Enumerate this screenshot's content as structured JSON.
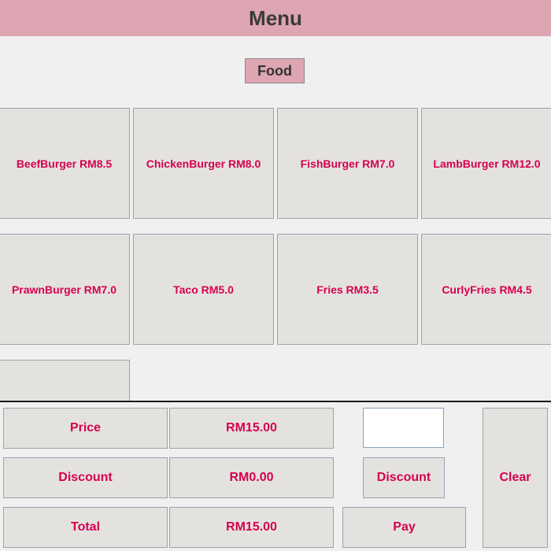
{
  "header": {
    "title": "Menu"
  },
  "tabs": [
    {
      "label": "Food",
      "active": true
    }
  ],
  "menu_items": [
    {
      "label": "BeefBurger RM8.5"
    },
    {
      "label": "ChickenBurger RM8.0"
    },
    {
      "label": "FishBurger RM7.0"
    },
    {
      "label": "LambBurger RM12.0"
    },
    {
      "label": "PrawnBurger RM7.0"
    },
    {
      "label": "Taco RM5.0"
    },
    {
      "label": "Fries RM3.5"
    },
    {
      "label": "CurlyFries RM4.5"
    },
    {
      "label": ""
    }
  ],
  "summary": {
    "price_label": "Price",
    "price_value": "RM15.00",
    "discount_label": "Discount",
    "discount_value": "RM0.00",
    "total_label": "Total",
    "total_value": "RM15.00"
  },
  "controls": {
    "discount_input_value": "",
    "discount_button": "Discount",
    "pay_button": "Pay",
    "clear_button": "Clear"
  },
  "colors": {
    "accent": "#dea5b2",
    "text_accent": "#d6004f",
    "button_bg": "#e4e2df",
    "page_bg": "#f0f0f0"
  }
}
